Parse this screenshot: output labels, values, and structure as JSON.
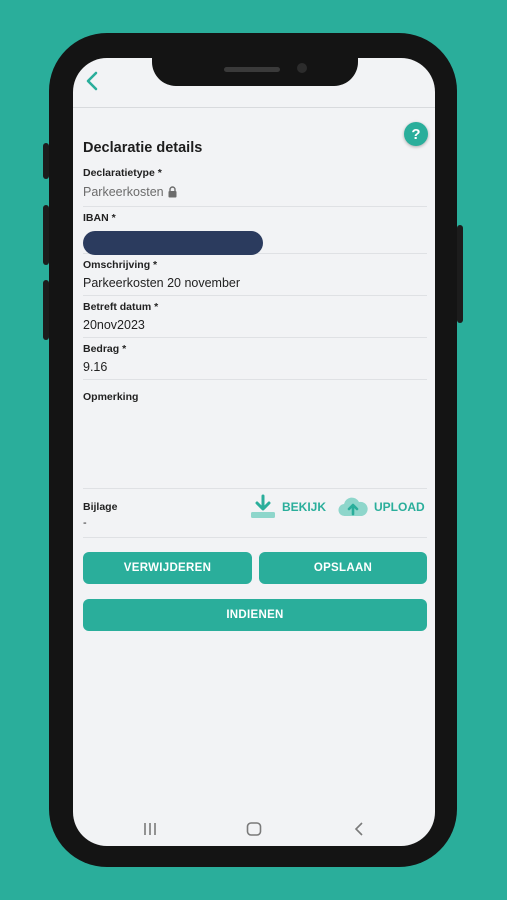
{
  "header": {
    "back_icon": "chevron-left-icon",
    "help_label": "?"
  },
  "form": {
    "title": "Declaratie details",
    "declaratietype": {
      "label": "Declaratietype *",
      "value": "Parkeerkosten",
      "icon": "lock-icon"
    },
    "iban": {
      "label": "IBAN *",
      "value_masked": true
    },
    "omschrijving": {
      "label": "Omschrijving *",
      "value": "Parkeerkosten 20 november"
    },
    "datum": {
      "label": "Betreft datum *",
      "value": "20nov2023"
    },
    "bedrag": {
      "label": "Bedrag *",
      "value": "9.16"
    },
    "opmerking": {
      "label": "Opmerking",
      "value": ""
    },
    "bijlage": {
      "label": "Bijlage",
      "value": "-",
      "view_label": "BEKIJK",
      "upload_label": "UPLOAD"
    }
  },
  "buttons": {
    "delete": "VERWIJDEREN",
    "save": "OPSLAAN",
    "submit": "INDIENEN"
  },
  "colors": {
    "accent": "#2aae9b",
    "mask": "#2b3b5e",
    "background": "#f2f3f5"
  }
}
